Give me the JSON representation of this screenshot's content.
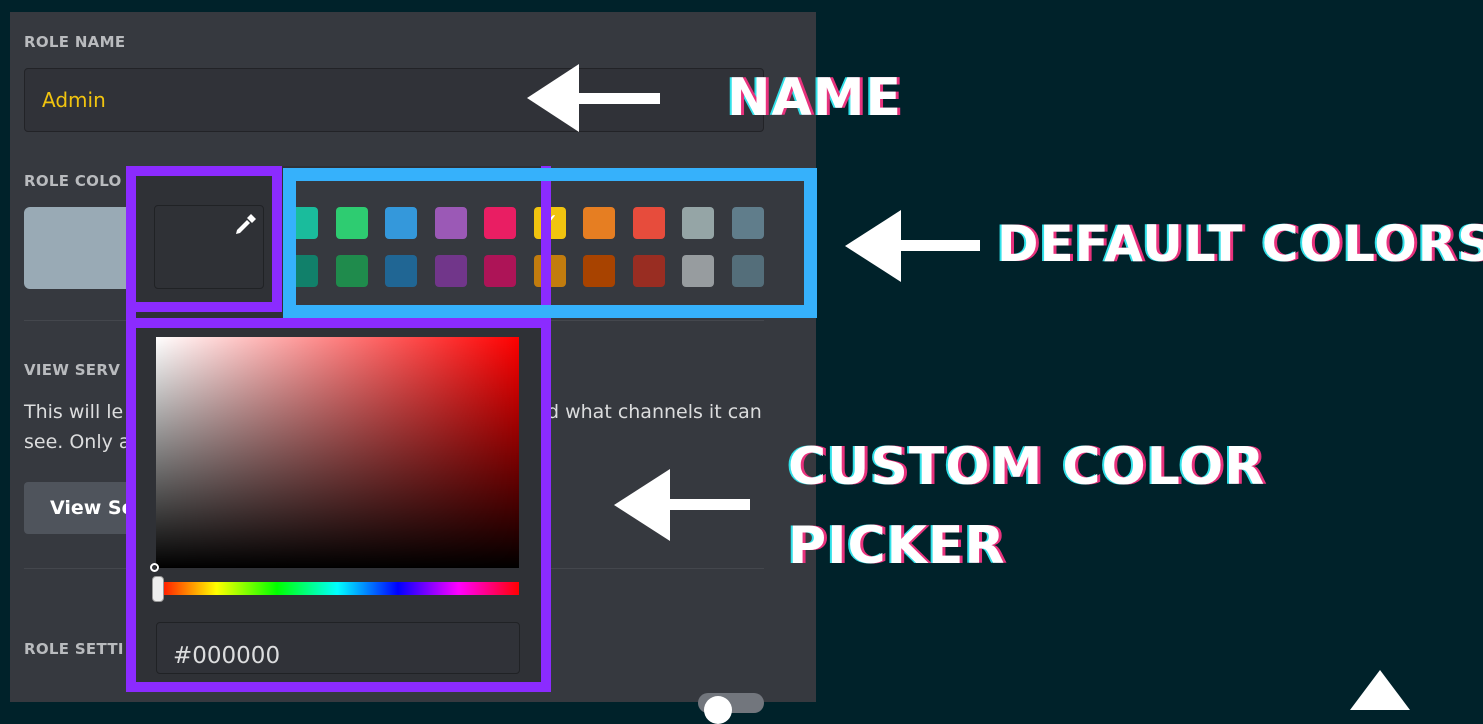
{
  "role_name": {
    "label": "ROLE NAME",
    "value": "Admin"
  },
  "role_color": {
    "label": "ROLE COLO",
    "hex_value": "#000000",
    "selected_preview": "#99aab5"
  },
  "view_server": {
    "label": "VIEW SERV",
    "desc_left_1": "This will le",
    "desc_right_1": "d what channels it can",
    "desc_left_2": "see. Only a",
    "button_label": "View Se"
  },
  "role_settings": {
    "label": "ROLE SETTI"
  },
  "swatches": {
    "row1": [
      "#1abc9c",
      "#2ecc71",
      "#3498db",
      "#9b59b6",
      "#e91e63",
      "#f1c40f",
      "#e67e22",
      "#e74c3c",
      "#95a5a6",
      "#607d8b"
    ],
    "row2": [
      "#11806a",
      "#1f8b4c",
      "#206694",
      "#71368a",
      "#ad1457",
      "#c27c0e",
      "#a84300",
      "#992d22",
      "#979c9f",
      "#546e7a"
    ],
    "selected": "#f1c40f"
  },
  "annotations": {
    "name": "NAME",
    "default_colors": "DEFAULT COLORS",
    "custom_line1": "CUSTOM COLOR",
    "custom_line2": "PICKER"
  },
  "icons": {
    "eyedropper": "eyedropper-icon",
    "check": "check-icon",
    "arrow": "arrow-left-icon"
  },
  "colors": {
    "background": "#00222a",
    "panel": "#36393f",
    "purple_box": "#8b2bff",
    "blue_box": "#36b1fb",
    "role_name_text": "#f1c40f"
  }
}
